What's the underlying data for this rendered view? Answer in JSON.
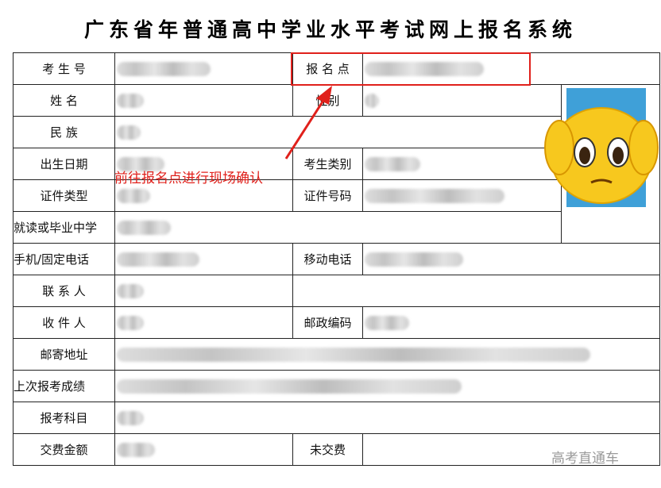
{
  "title": "广东省年普通高中学业水平考试网上报名系统",
  "labels": {
    "exam_no": "考 生 号",
    "site": "报 名 点",
    "name": "姓  名",
    "gender": "性别",
    "ethnicity": "民 族",
    "birth": "出生日期",
    "category": "考生类别",
    "id_type": "证件类型",
    "id_no": "证件号码",
    "school": "就读或毕业中学",
    "phone": "手机/固定电话",
    "mobile": "移动电话",
    "contact": "联 系 人",
    "recipient": "收 件 人",
    "postcode": "邮政编码",
    "address": "邮寄地址",
    "last_score": "上次报考成绩",
    "subjects": "报考科目",
    "fee": "交费金额",
    "fee_status": "未交费"
  },
  "annotation": {
    "text": "前往报名点进行现场确认",
    "color": "#e0201b"
  },
  "watermark": "高考直通车",
  "icons": {
    "photo": "id-photo",
    "sticker": "shocked-face-emoji-icon",
    "arrow": "red-arrow-icon"
  }
}
